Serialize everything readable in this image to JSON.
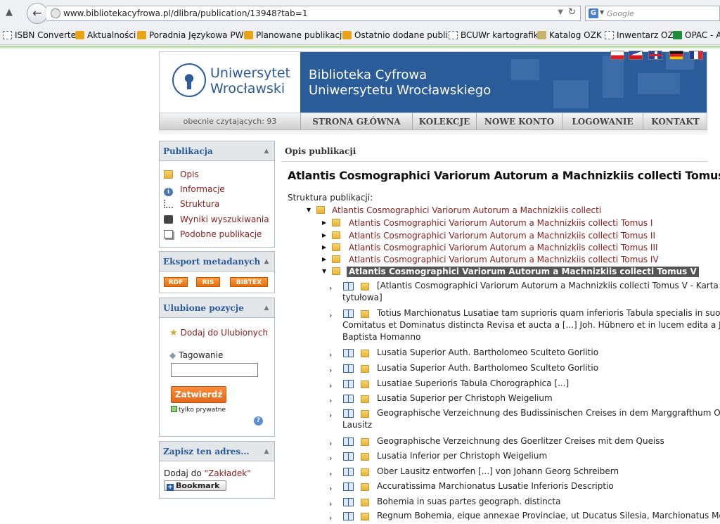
{
  "browser": {
    "url": "www.bibliotekacyfrowa.pl/dlibra/publication/13948?tab=1",
    "search_placeholder": "Google",
    "search_engine_icon": "G",
    "bookmarks": [
      {
        "label": "ISBN Converter",
        "icon": "page"
      },
      {
        "label": "Aktualności",
        "icon": "rss"
      },
      {
        "label": "Poradnia Językowa PWN",
        "icon": "rss"
      },
      {
        "label": "Planowane publikacje",
        "icon": "rss"
      },
      {
        "label": "Ostatnio dodane publi...",
        "icon": "rss"
      },
      {
        "label": "BCUWr kartografika",
        "icon": "page"
      },
      {
        "label": "Katalog OZK",
        "icon": "kat"
      },
      {
        "label": "Inwentarz OZK",
        "icon": "page"
      },
      {
        "label": "OPAC - A",
        "icon": "sheet"
      }
    ]
  },
  "header": {
    "logo_line1": "Uniwersytet",
    "logo_line2": "Wrocławski",
    "banner_line1": "Biblioteka Cyfrowa",
    "banner_line2": "Uniwersytetu Wrocławskiego",
    "brand_color": "#2a5c9a"
  },
  "nav": {
    "readers": "obecnie czytających: 93",
    "items": [
      "STRONA GŁÓWNA",
      "KOLEKCJE",
      "NOWE KONTO",
      "LOGOWANIE",
      "KONTAKT"
    ]
  },
  "sidebar": {
    "publication": {
      "title": "Publikacja",
      "items": [
        {
          "label": "Opis",
          "icon": "folder-icon"
        },
        {
          "label": "Informacje",
          "icon": "info-icon"
        },
        {
          "label": "Struktura",
          "icon": "tree-icon"
        },
        {
          "label": "Wyniki wyszukiwania",
          "icon": "binoculars-icon"
        },
        {
          "label": "Podobne publikacje",
          "icon": "pages-icon"
        }
      ]
    },
    "export": {
      "title": "Eksport metadanych",
      "buttons": [
        "RDF",
        "RIS",
        "BIBTEX"
      ]
    },
    "favorites": {
      "title": "Ulubione pozycje",
      "add_label": "Dodaj do Ulubionych",
      "tag_label": "Tagowanie",
      "tag_value": "",
      "submit_label": "Zatwierdź",
      "private_label": "tylko prywatne",
      "private_checked": true
    },
    "address": {
      "title": "Zapisz ten adres...",
      "text_prefix": "Dodaj do ",
      "link_label": "\"Zakładek\"",
      "bookmark_label": "Bookmark"
    }
  },
  "main": {
    "section_title": "Opis publikacji",
    "title": "Atlantis Cosmographici Variorum Autorum a Machnizkiis collecti Tomus V",
    "structure_label": "Struktura publikacji:",
    "tree_root": "Atlantis Cosmographici Variorum Autorum a Machnizkiis collecti",
    "tree_volumes": [
      "Atlantis Cosmographici Variorum Autorum a Machnizkiis collecti Tomus I",
      "Atlantis Cosmographici Variorum Autorum a Machnizkiis collecti Tomus II",
      "Atlantis Cosmographici Variorum Autorum a Machnizkiis collecti Tomus III",
      "Atlantis Cosmographici Variorum Autorum a Machnizkiis collecti Tomus IV"
    ],
    "tree_selected": "Atlantis Cosmographici Variorum Autorum a Machnizkiis collecti Tomus V",
    "tree_children": [
      {
        "line1": "[Atlantis Cosmographici Variorum Autorum a Machnizkiis collecti Tomus V - Karta",
        "line2": "tytułowa]"
      },
      {
        "line1": "Totius Marchionatus Lusatiae tam suprioris quam inferioris Tabula specialis in suos",
        "line2": "Comitatus et Dominatus distincta Revisa et aucta a [...] Joh. Hübnero et in lucem edita a Joh.",
        "line3": "Baptista Homanno"
      },
      {
        "line1": "Lusatia Superior Auth. Bartholomeo Sculteto Gorlitio"
      },
      {
        "line1": "Lusatia Superior Auth. Bartholomeo Sculteto Gorlitio"
      },
      {
        "line1": "Lusatiae Superioris Tabula Chorographica [...]"
      },
      {
        "line1": "Lusatia Superior per Christoph Weigelium"
      },
      {
        "line1": "Geographische Verzeichnung des Budissinischen Creises in dem Marggrafthum Ober",
        "line2": "Lausitz"
      },
      {
        "line1": "Geographische Verzeichnung des Goerlitzer Creises mit dem Queiss"
      },
      {
        "line1": "Lusatia Inferior per Christoph Weigelium"
      },
      {
        "line1": "Ober Lausitz entworfen [...] von Johann Georg Schreibern"
      },
      {
        "line1": "Accuratissima Marchionatus Lusatie Inferioris Descriptio"
      },
      {
        "line1": "Bohemia in suas partes geograph. distincta"
      },
      {
        "line1": "Regnum Bohemia, eique annexae Provinciae, ut Ducatus Silesia, Marchionatus Moravia"
      }
    ]
  }
}
